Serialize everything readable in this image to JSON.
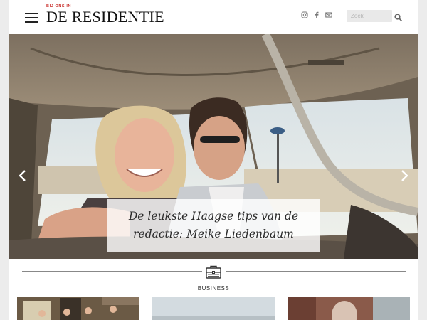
{
  "header": {
    "logo_sub": "BIJ ONS IN",
    "logo": "DE RESIDENTIE",
    "social_icons": [
      "instagram-icon",
      "facebook-icon",
      "envelope-icon"
    ],
    "search_placeholder": "Zoek"
  },
  "hero": {
    "caption": "De leukste Haagse tips van de redactie: Meike Liedenbaum"
  },
  "section": {
    "title": "BUSINESS",
    "icon": "briefcase-icon"
  },
  "colors": {
    "logo_accent": "#c9302c",
    "divider": "#888888"
  }
}
